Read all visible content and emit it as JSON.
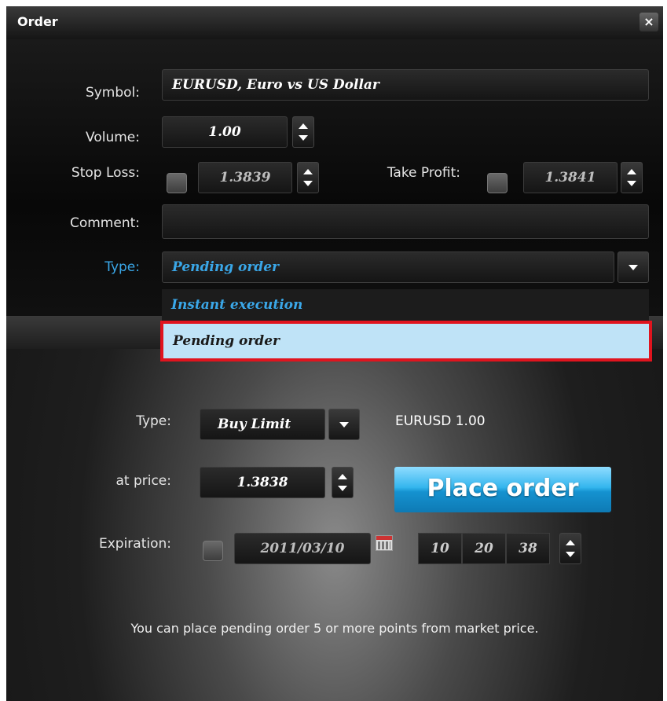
{
  "window": {
    "title": "Order",
    "close_label": "×"
  },
  "form": {
    "symbol_label": "Symbol:",
    "symbol_value": "EURUSD, Euro vs US Dollar",
    "volume_label": "Volume:",
    "volume_value": "1.00",
    "stop_loss_label": "Stop Loss:",
    "stop_loss_value": "1.3839",
    "take_profit_label": "Take Profit:",
    "take_profit_value": "1.3841",
    "comment_label": "Comment:",
    "comment_value": "",
    "type_label": "Type:",
    "type_value": "Pending order",
    "type_options": [
      "Instant execution",
      "Pending order"
    ]
  },
  "pending": {
    "type_label": "Type:",
    "type_value": "Buy Limit",
    "summary": "EURUSD 1.00",
    "price_label": "at price:",
    "price_value": "1.3838",
    "place_button": "Place order",
    "expiration_label": "Expiration:",
    "expiration_date": "2011/03/10",
    "time_hour": "10",
    "time_minute": "20",
    "time_second": "38"
  },
  "note": "You can place pending order 5 or more points from market price.",
  "colors": {
    "accent_blue": "#3aa7e8",
    "highlight": "#bfe3f7",
    "highlight_border": "#e0141e"
  }
}
